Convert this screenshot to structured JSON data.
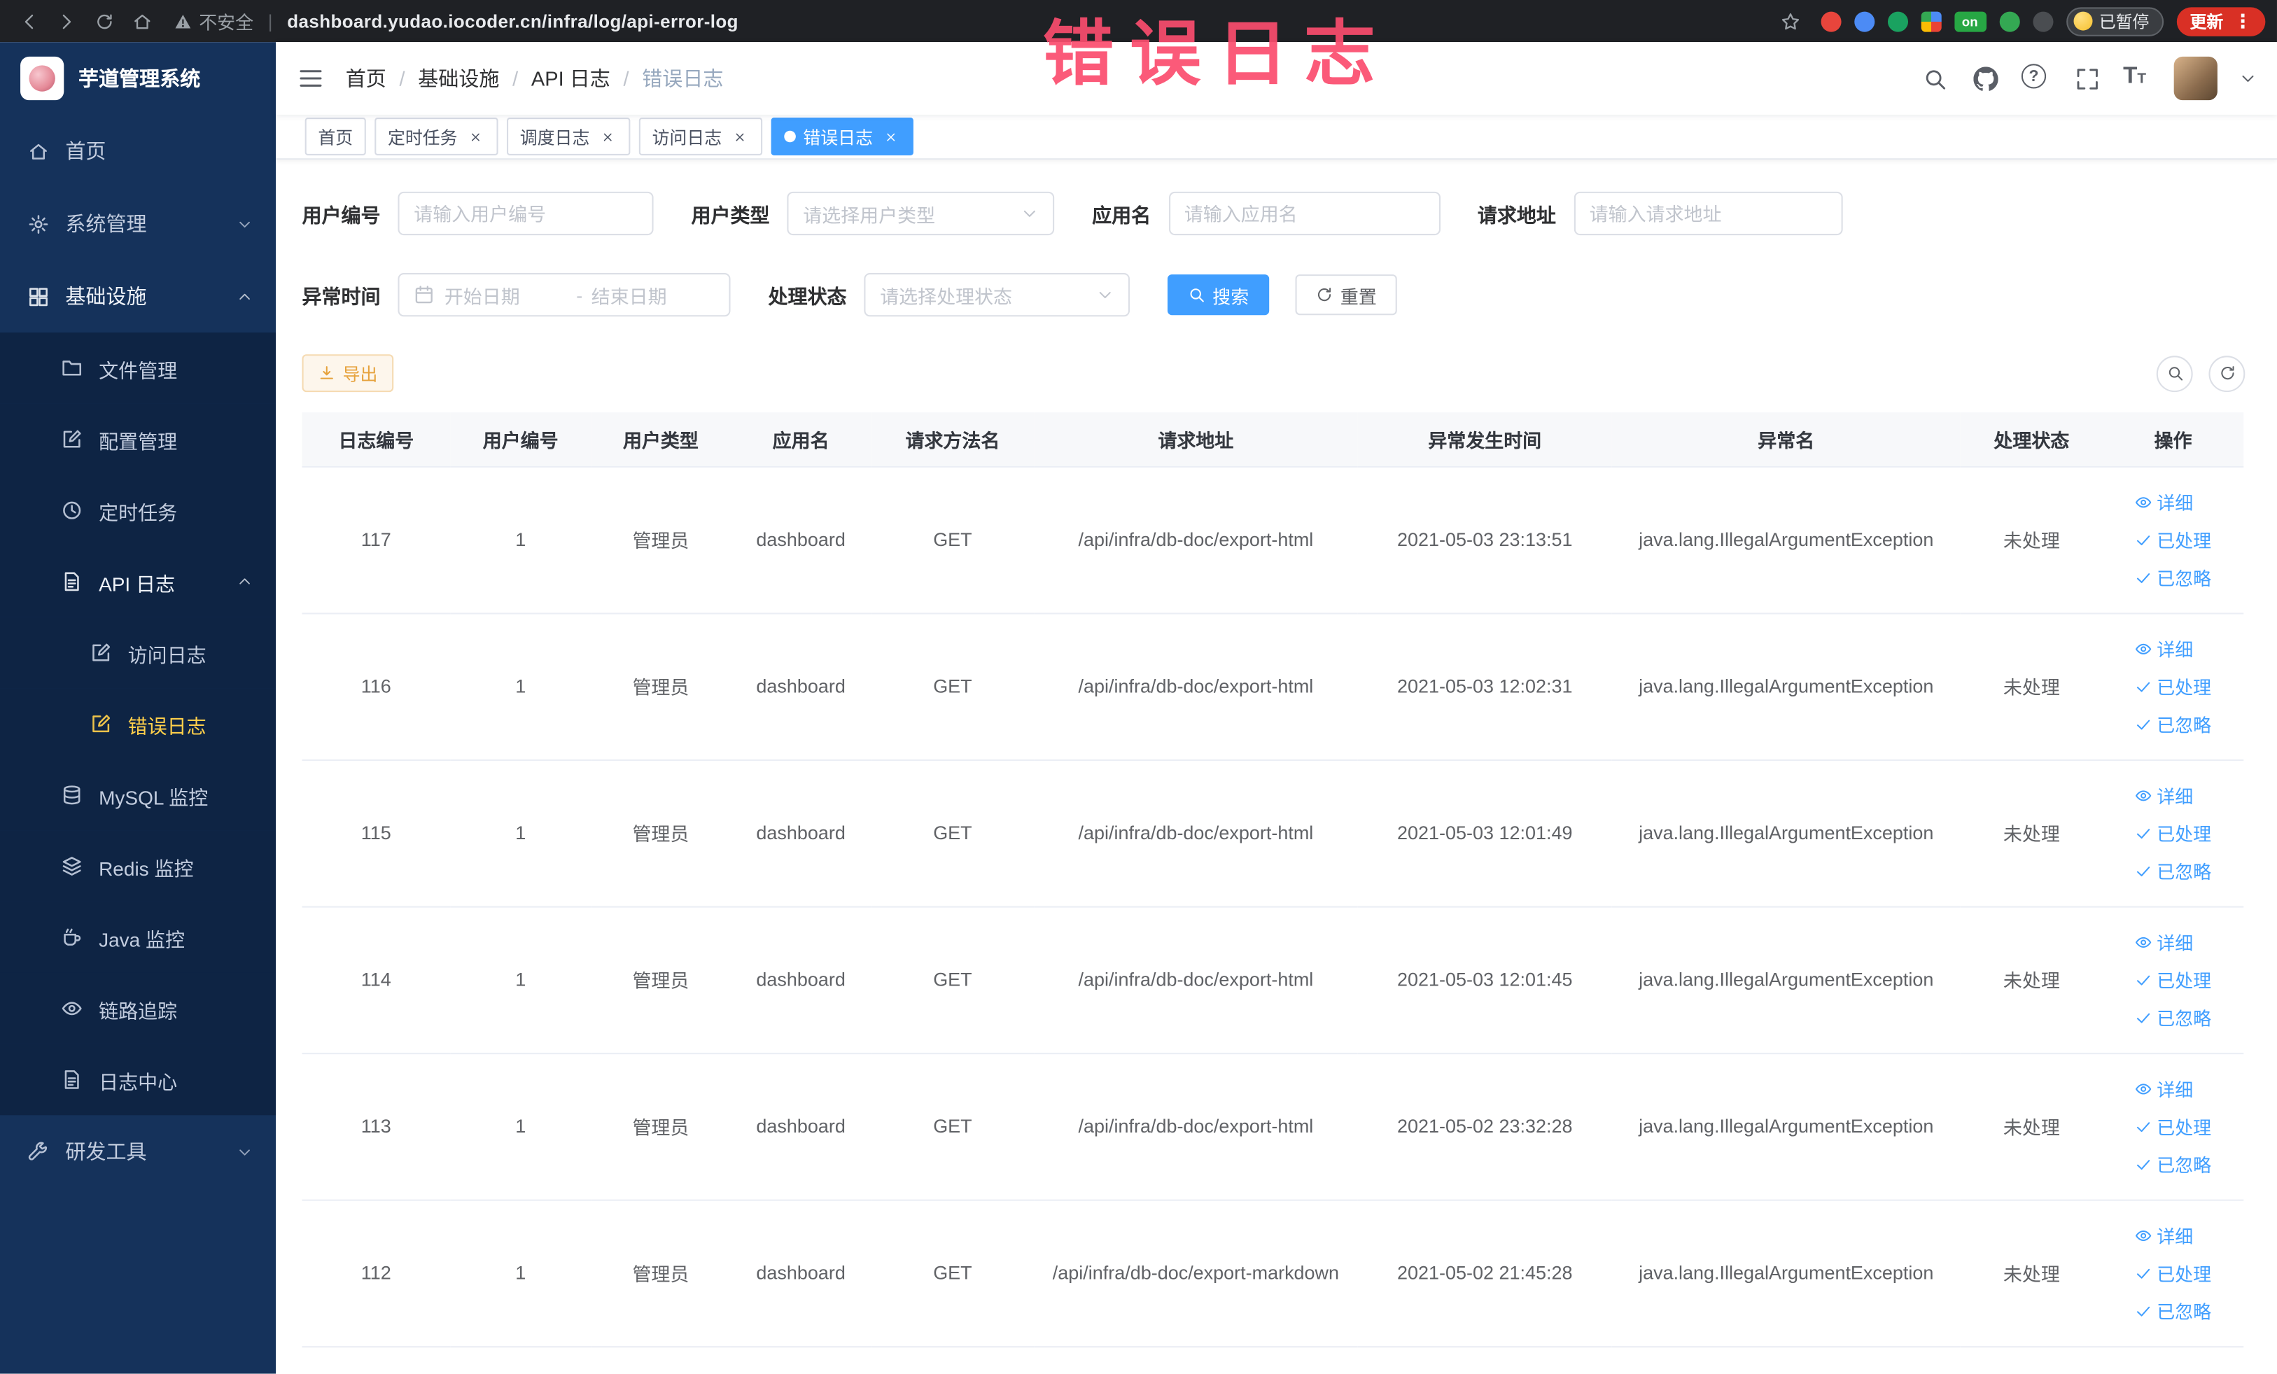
{
  "annotation": {
    "text": "错误日志",
    "color": "#fb4d6e"
  },
  "browser": {
    "security_label": "不安全",
    "url": "dashboard.yudao.iocoder.cn/infra/log/api-error-log",
    "divider": "|",
    "extension_badge": "on",
    "paused_badge": "已暂停",
    "update_button": "更新"
  },
  "sidebar": {
    "logo_title": "芋道管理系统",
    "menu": [
      {
        "key": "home",
        "label": "首页",
        "icon": "home-icon",
        "level": 1
      },
      {
        "key": "system",
        "label": "系统管理",
        "icon": "gear-icon",
        "level": 1,
        "arrow": "down"
      },
      {
        "key": "infra",
        "label": "基础设施",
        "icon": "grid-icon",
        "level": 1,
        "arrow": "up",
        "expanded": true
      },
      {
        "key": "file",
        "label": "文件管理",
        "icon": "folder-icon",
        "level": 2
      },
      {
        "key": "config",
        "label": "配置管理",
        "icon": "edit-icon",
        "level": 2
      },
      {
        "key": "job",
        "label": "定时任务",
        "icon": "clock-icon",
        "level": 2
      },
      {
        "key": "api-log",
        "label": "API 日志",
        "icon": "document-icon",
        "level": 2,
        "arrow": "up",
        "expanded": true
      },
      {
        "key": "access-log",
        "label": "访问日志",
        "icon": "edit-icon",
        "level": 3
      },
      {
        "key": "error-log",
        "label": "错误日志",
        "icon": "edit-icon",
        "level": 3,
        "active": true
      },
      {
        "key": "mysql",
        "label": "MySQL 监控",
        "icon": "database-icon",
        "level": 2
      },
      {
        "key": "redis",
        "label": "Redis 监控",
        "icon": "layers-icon",
        "level": 2
      },
      {
        "key": "java",
        "label": "Java 监控",
        "icon": "coffee-icon",
        "level": 2
      },
      {
        "key": "trace",
        "label": "链路追踪",
        "icon": "eye-icon",
        "level": 2
      },
      {
        "key": "log-center",
        "label": "日志中心",
        "icon": "document-icon",
        "level": 2
      },
      {
        "key": "dev-tools",
        "label": "研发工具",
        "icon": "wrench-icon",
        "level": 1,
        "arrow": "down"
      }
    ]
  },
  "header": {
    "breadcrumb": [
      "首页",
      "基础设施",
      "API 日志",
      "错误日志"
    ],
    "breadcrumb_separator": "/"
  },
  "tags": [
    {
      "label": "首页",
      "closable": false,
      "active": false
    },
    {
      "label": "定时任务",
      "closable": true,
      "active": false
    },
    {
      "label": "调度日志",
      "closable": true,
      "active": false
    },
    {
      "label": "访问日志",
      "closable": true,
      "active": false
    },
    {
      "label": "错误日志",
      "closable": true,
      "active": true
    }
  ],
  "filters": {
    "user_id": {
      "label": "用户编号",
      "placeholder": "请输入用户编号"
    },
    "user_type": {
      "label": "用户类型",
      "placeholder": "请选择用户类型"
    },
    "app_name": {
      "label": "应用名",
      "placeholder": "请输入应用名"
    },
    "request_url": {
      "label": "请求地址",
      "placeholder": "请输入请求地址"
    },
    "exception_time": {
      "label": "异常时间",
      "start_placeholder": "开始日期",
      "separator": "-",
      "end_placeholder": "结束日期"
    },
    "process_status": {
      "label": "处理状态",
      "placeholder": "请选择处理状态"
    },
    "search_button": "搜索",
    "reset_button": "重置"
  },
  "toolbar": {
    "export_label": "导出"
  },
  "table": {
    "columns": [
      "日志编号",
      "用户编号",
      "用户类型",
      "应用名",
      "请求方法名",
      "请求地址",
      "异常发生时间",
      "异常名",
      "处理状态",
      "操作"
    ],
    "action_labels": [
      "详细",
      "已处理",
      "已忽略"
    ],
    "rows": [
      {
        "cells": [
          "117",
          "1",
          "管理员",
          "dashboard",
          "GET",
          "/api/infra/db-doc/export-html",
          "2021-05-03 23:13:51",
          "java.lang.IllegalArgumentException",
          "未处理"
        ]
      },
      {
        "cells": [
          "116",
          "1",
          "管理员",
          "dashboard",
          "GET",
          "/api/infra/db-doc/export-html",
          "2021-05-03 12:02:31",
          "java.lang.IllegalArgumentException",
          "未处理"
        ]
      },
      {
        "cells": [
          "115",
          "1",
          "管理员",
          "dashboard",
          "GET",
          "/api/infra/db-doc/export-html",
          "2021-05-03 12:01:49",
          "java.lang.IllegalArgumentException",
          "未处理"
        ]
      },
      {
        "cells": [
          "114",
          "1",
          "管理员",
          "dashboard",
          "GET",
          "/api/infra/db-doc/export-html",
          "2021-05-03 12:01:45",
          "java.lang.IllegalArgumentException",
          "未处理"
        ]
      },
      {
        "cells": [
          "113",
          "1",
          "管理员",
          "dashboard",
          "GET",
          "/api/infra/db-doc/export-html",
          "2021-05-02 23:32:28",
          "java.lang.IllegalArgumentException",
          "未处理"
        ]
      },
      {
        "cells": [
          "112",
          "1",
          "管理员",
          "dashboard",
          "GET",
          "/api/infra/db-doc/export-markdown",
          "2021-05-02 21:45:28",
          "java.lang.IllegalArgumentException",
          "未处理"
        ]
      }
    ]
  },
  "colors": {
    "primary": "#409eff",
    "menu_active": "#ffd04b",
    "warning": "#e6a23c"
  }
}
